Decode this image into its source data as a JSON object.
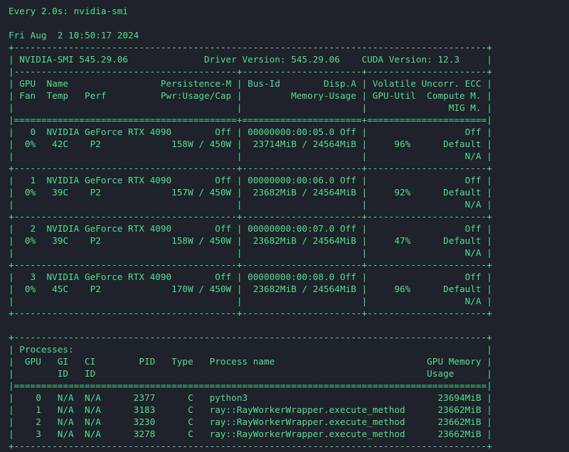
{
  "terminal": {
    "background": "#1f212b",
    "foreground": "#4ee08a",
    "lines": [
      "Every 2.0s: nvidia-smi",
      "",
      "Fri Aug  2 10:50:17 2024",
      "+---------------------------------------------------------------------------------------+",
      "| NVIDIA-SMI 545.29.06              Driver Version: 545.29.06    CUDA Version: 12.3     |",
      "|-----------------------------------------+----------------------+----------------------+",
      "| GPU  Name                 Persistence-M | Bus-Id        Disp.A | Volatile Uncorr. ECC |",
      "| Fan  Temp   Perf          Pwr:Usage/Cap |         Memory-Usage | GPU-Util  Compute M. |",
      "|                                         |                      |               MIG M. |",
      "|=========================================+======================+======================|",
      "|   0  NVIDIA GeForce RTX 4090        Off | 00000000:00:05.0 Off |                  Off |",
      "|  0%   42C    P2             158W / 450W |  23714MiB / 24564MiB |     96%      Default |",
      "|                                         |                      |                  N/A |",
      "+-----------------------------------------+----------------------+----------------------+",
      "|   1  NVIDIA GeForce RTX 4090        Off | 00000000:00:06.0 Off |                  Off |",
      "|  0%   39C    P2             157W / 450W |  23682MiB / 24564MiB |     92%      Default |",
      "|                                         |                      |                  N/A |",
      "+-----------------------------------------+----------------------+----------------------+",
      "|   2  NVIDIA GeForce RTX 4090        Off | 00000000:00:07.0 Off |                  Off |",
      "|  0%   39C    P2             158W / 450W |  23682MiB / 24564MiB |     47%      Default |",
      "|                                         |                      |                  N/A |",
      "+-----------------------------------------+----------------------+----------------------+",
      "|   3  NVIDIA GeForce RTX 4090        Off | 00000000:00:08.0 Off |                  Off |",
      "|  0%   45C    P2             170W / 450W |  23682MiB / 24564MiB |     96%      Default |",
      "|                                         |                      |                  N/A |",
      "+-----------------------------------------+----------------------+----------------------+",
      "",
      "+---------------------------------------------------------------------------------------+",
      "| Processes:                                                                            |",
      "|  GPU   GI   CI        PID   Type   Process name                            GPU Memory |",
      "|        ID   ID                                                             Usage      |",
      "|=======================================================================================|",
      "|    0   N/A  N/A      2377      C   python3                                   23694MiB |",
      "|    1   N/A  N/A      3183      C   ray::RayWorkerWrapper.execute_method      23662MiB |",
      "|    2   N/A  N/A      3230      C   ray::RayWorkerWrapper.execute_method      23662MiB |",
      "|    3   N/A  N/A      3278      C   ray::RayWorkerWrapper.execute_method      23662MiB |",
      "+---------------------------------------------------------------------------------------+"
    ]
  }
}
